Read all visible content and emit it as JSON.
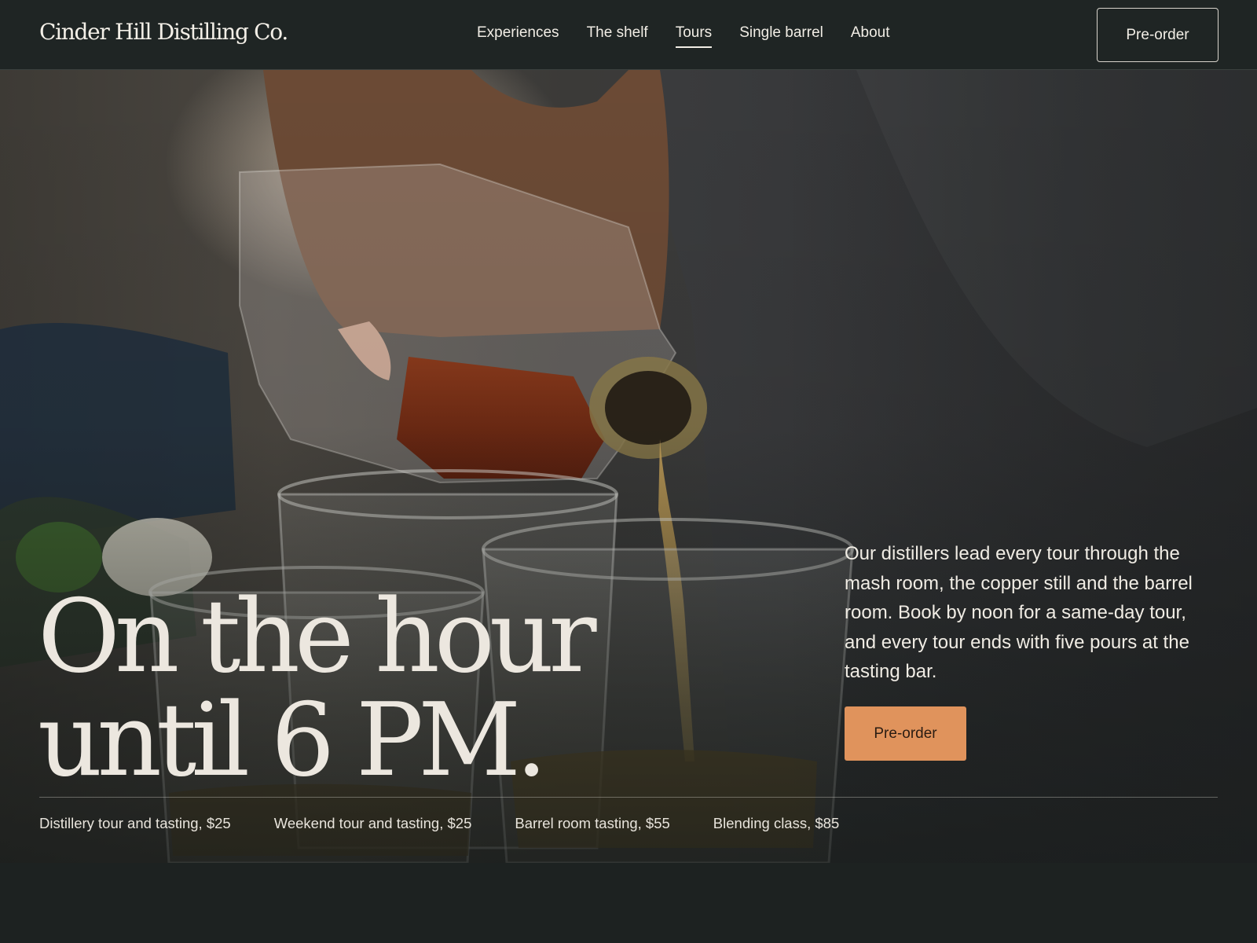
{
  "header": {
    "brand": "Cinder Hill Distilling Co.",
    "nav": [
      {
        "label": "Experiences",
        "active": false
      },
      {
        "label": "The shelf",
        "active": false
      },
      {
        "label": "Tours",
        "active": true
      },
      {
        "label": "Single barrel",
        "active": false
      },
      {
        "label": "About",
        "active": false
      }
    ],
    "cta_label": "Pre-order"
  },
  "hero": {
    "headline_line1": "On the hour",
    "headline_line2": "until 6 PM.",
    "intro": "Our distillers lead every tour through the mash room, the copper still and the barrel room. Book by noon for a same-day tour, and every tour ends with five pours at the tasting bar.",
    "cta_label": "Pre-order",
    "photo_description_icon": "pouring-whiskey-photo"
  },
  "offerings": [
    "Distillery tour and tasting, $25",
    "Weekend tour and tasting, $25",
    "Barrel room tasting, $55",
    "Blending class, $85"
  ],
  "colors": {
    "background": "#1d2221",
    "header": "#1f2524",
    "accent": "#e0935c",
    "text": "#ece8e0"
  }
}
